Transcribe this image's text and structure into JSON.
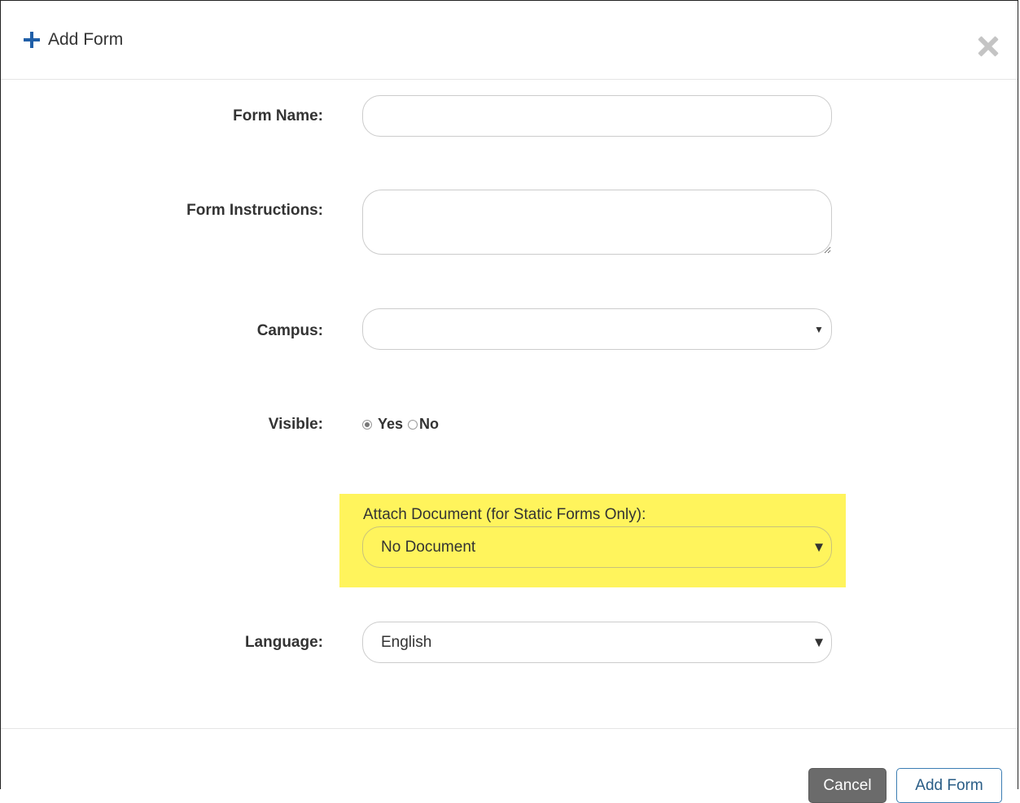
{
  "dialog": {
    "title": "Add Form",
    "icons": {
      "header": "plus-icon",
      "close": "close-icon"
    }
  },
  "form": {
    "form_name": {
      "label": "Form Name:",
      "value": ""
    },
    "form_instructions": {
      "label": "Form Instructions:",
      "value": ""
    },
    "campus": {
      "label": "Campus:",
      "value": ""
    },
    "visible": {
      "label": "Visible:",
      "options": [
        {
          "label": "Yes",
          "selected": true
        },
        {
          "label": "No",
          "selected": false
        }
      ]
    },
    "attach_document": {
      "label": "Attach Document (for Static Forms Only):",
      "value": "No Document"
    },
    "language": {
      "label": "Language:",
      "value": "English"
    }
  },
  "footer": {
    "cancel_label": "Cancel",
    "add_label": "Add Form"
  },
  "colors": {
    "accent": "#1f5fa8",
    "highlight": "#fff45c",
    "cancel_bg": "#6b6b6b",
    "add_border": "#3b7db3"
  }
}
